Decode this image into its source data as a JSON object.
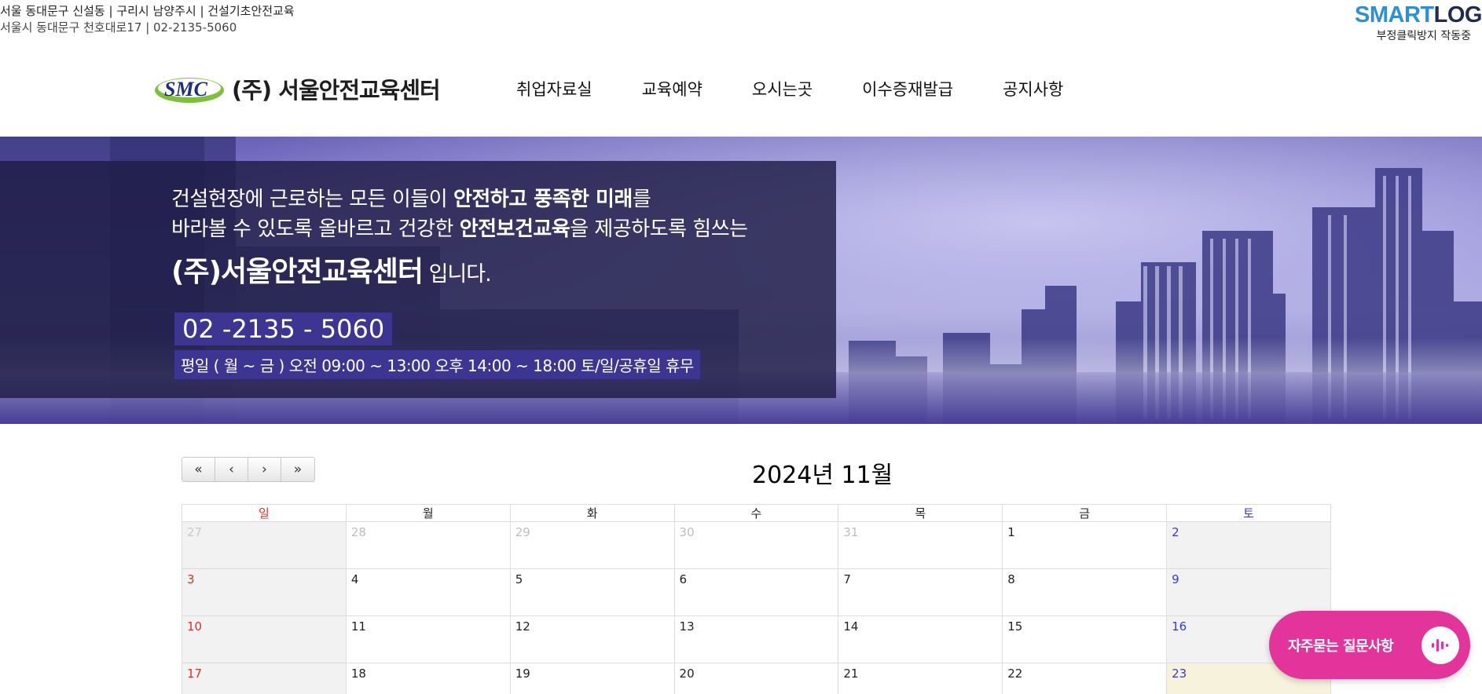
{
  "top_info": {
    "line1": "서울 동대문구 신설동 | 구리시 남양주시 | 건설기초안전교육",
    "line2": "서울시 동대문구 천호대로17 | 02-2135-5060"
  },
  "smartlog": {
    "logo_a": "SMART",
    "logo_b": "LOG",
    "sub": "부정클릭방지 작동중"
  },
  "header": {
    "emblem_text": "SMC",
    "company_name": "(주) 서울안전교육센터",
    "nav": [
      "취업자료실",
      "교육예약",
      "오시는곳",
      "이수증재발급",
      "공지사항"
    ]
  },
  "hero": {
    "line1_a": "건설현장에 근로하는 모든 이들이 ",
    "line1_b": "안전하고 풍족한 미래",
    "line1_c": "를",
    "line2_a": "바라볼 수 있도록 올바르고 건강한 ",
    "line2_b": "안전보건교육",
    "line2_c": "을 제공하도록 힘쓰는",
    "company_bold": "(주)서울안전교육센터",
    "company_suffix": " 입니다.",
    "phone": "02 -2135 - 5060",
    "hours": "평일 ( 월 ~ 금 ) 오전 09:00 ~ 13:00 오후 14:00 ~ 18:00  토/일/공휴일 휴무"
  },
  "calendar": {
    "nav": {
      "prev_year": "«",
      "prev": "‹",
      "next": "›",
      "next_year": "»"
    },
    "title": "2024년 11월",
    "weekdays": [
      "일",
      "월",
      "화",
      "수",
      "목",
      "금",
      "토"
    ],
    "rows": [
      [
        "27",
        "28",
        "29",
        "30",
        "31",
        "1",
        "2"
      ],
      [
        "3",
        "4",
        "5",
        "6",
        "7",
        "8",
        "9"
      ],
      [
        "10",
        "11",
        "12",
        "13",
        "14",
        "15",
        "16"
      ],
      [
        "17",
        "18",
        "19",
        "20",
        "21",
        "22",
        "23"
      ]
    ]
  },
  "faq": {
    "label": "자주묻는 질문사항"
  },
  "colors": {
    "accent": "#3c3592",
    "faq": "#e2349a",
    "sunday": "#e0302a",
    "saturday": "#3a3ac8"
  }
}
